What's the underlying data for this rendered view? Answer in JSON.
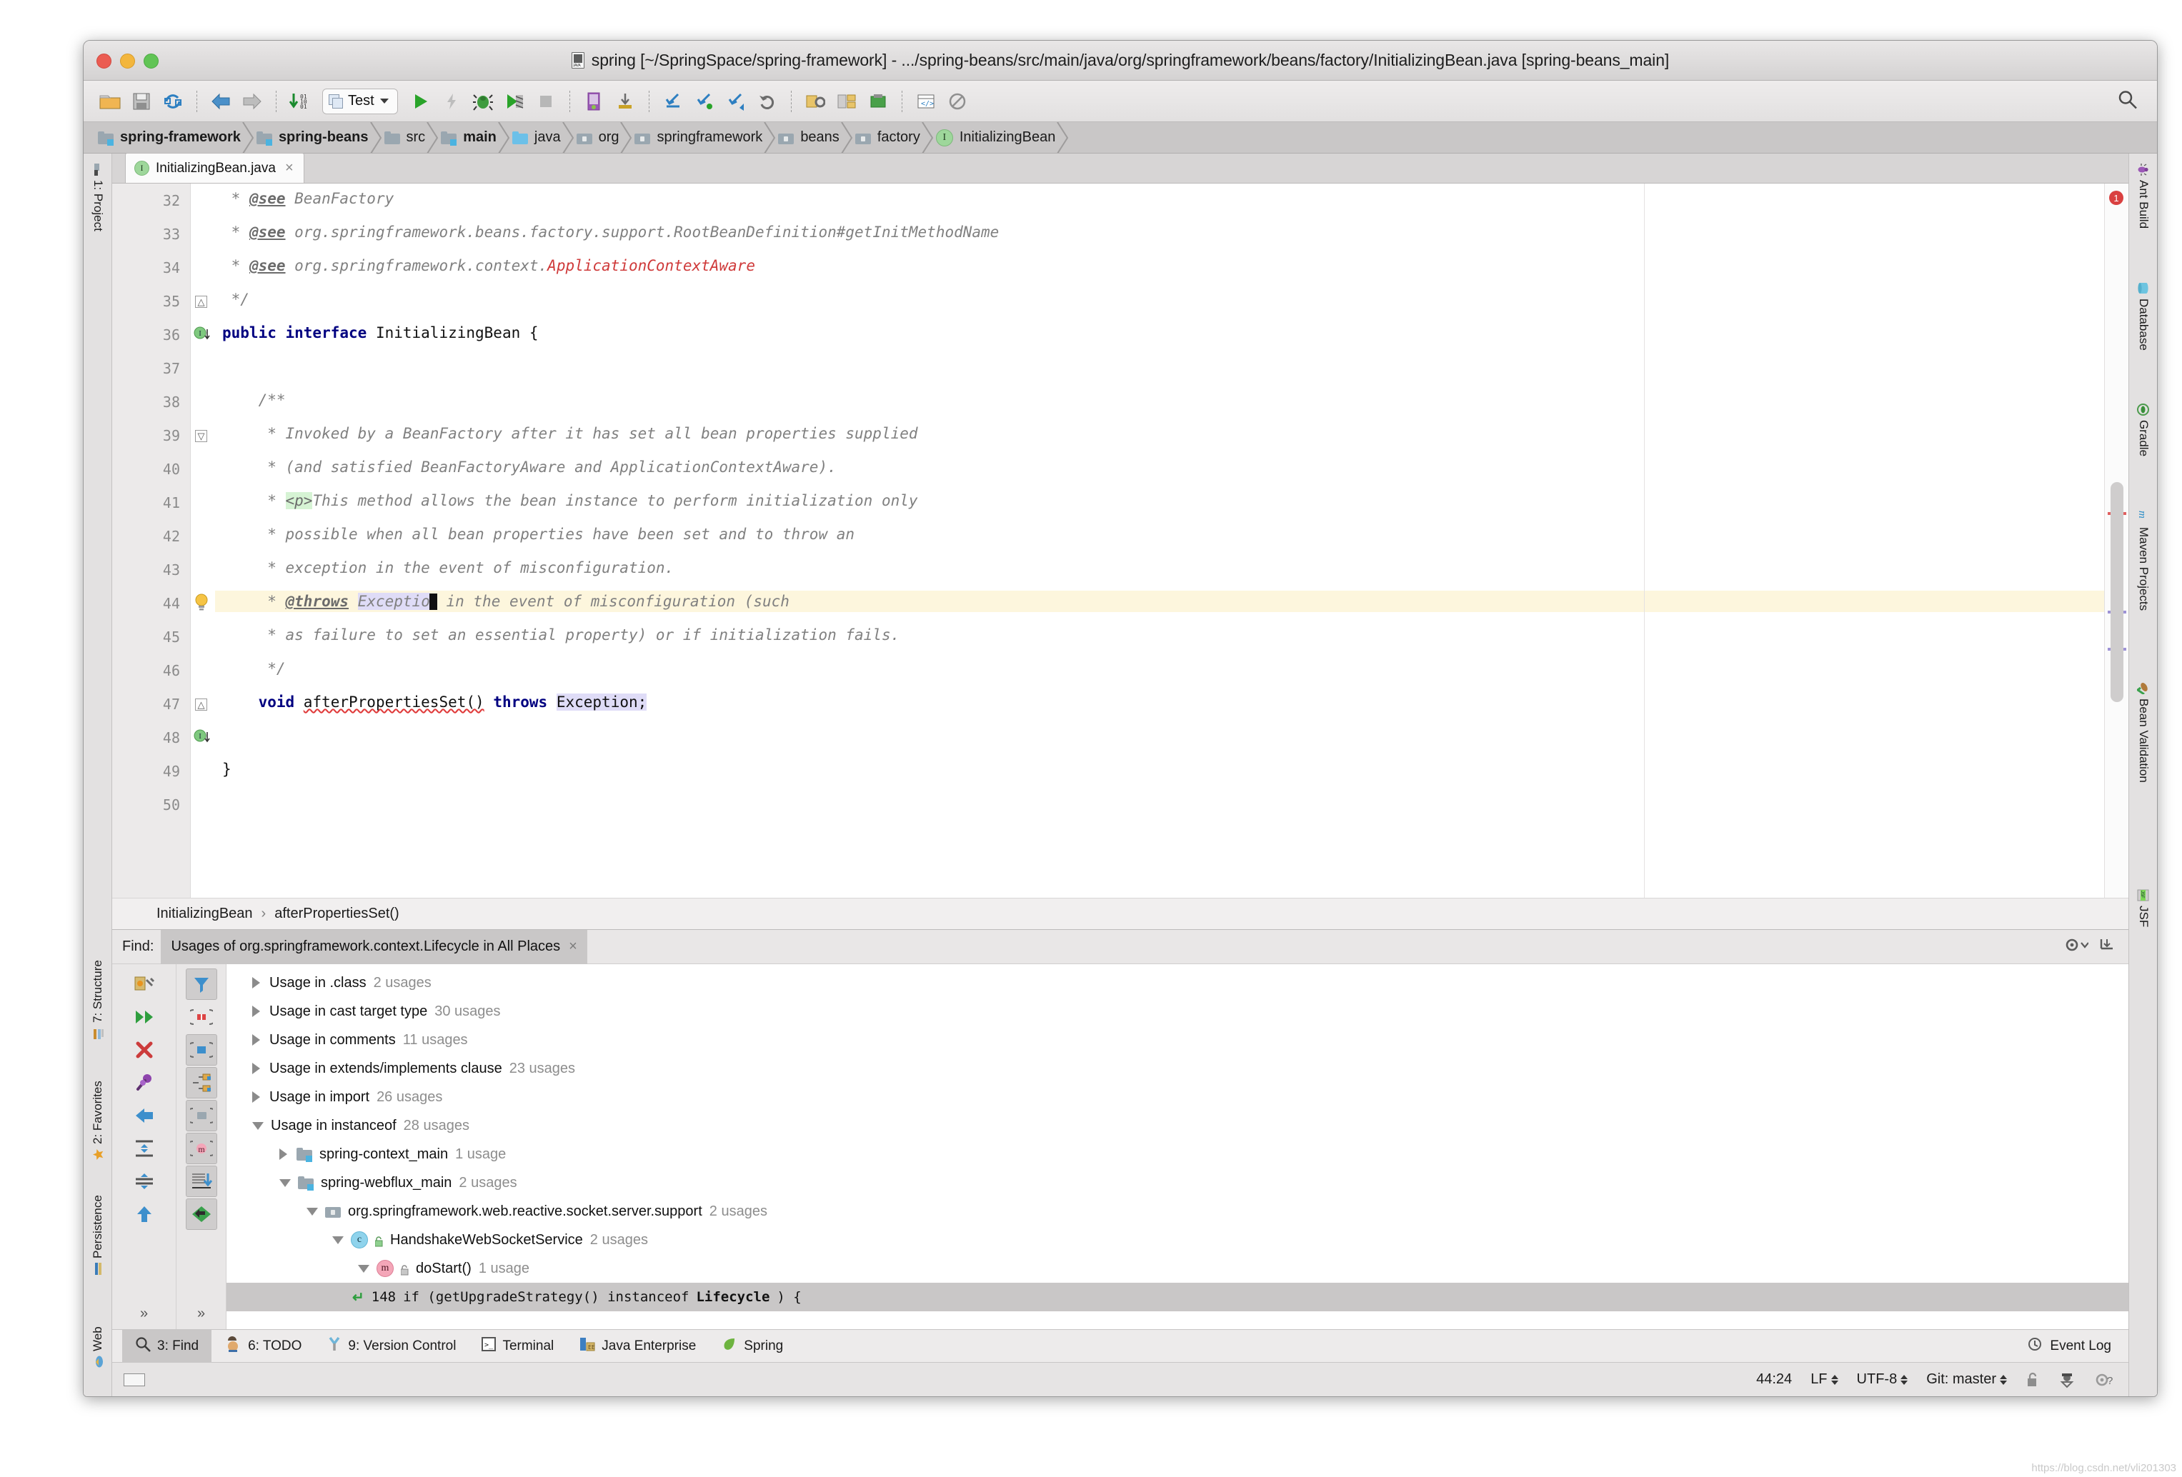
{
  "window": {
    "title": "spring [~/SpringSpace/spring-framework] - .../spring-beans/src/main/java/org/springframework/beans/factory/InitializingBean.java [spring-beans_main]",
    "file_icon": "java-file-icon"
  },
  "toolbar": {
    "run_config": "Test",
    "icons": [
      "open-folder-icon",
      "save-all-icon",
      "sync-icon",
      "back-icon",
      "forward-icon",
      "compile-icon",
      "run-icon",
      "run-fast-icon",
      "debug-icon",
      "coverage-icon",
      "stop-icon",
      "android-device-icon",
      "install-icon",
      "vcs-update-icon",
      "vcs-commit-icon",
      "vcs-push-icon",
      "undo-icon",
      "settings-icon",
      "project-structure-icon",
      "external-tool-icon",
      "web-preview-icon",
      "no-entry-icon"
    ],
    "search_icon": "search-icon"
  },
  "breadcrumb": [
    {
      "label": "spring-framework",
      "icon": "module-folder-icon",
      "bold": true
    },
    {
      "label": "spring-beans",
      "icon": "module-folder-icon",
      "bold": true
    },
    {
      "label": "src",
      "icon": "folder-icon",
      "bold": false
    },
    {
      "label": "main",
      "icon": "module-folder-icon",
      "bold": true
    },
    {
      "label": "java",
      "icon": "source-folder-icon",
      "bold": false
    },
    {
      "label": "org",
      "icon": "package-icon",
      "bold": false
    },
    {
      "label": "springframework",
      "icon": "package-icon",
      "bold": false
    },
    {
      "label": "beans",
      "icon": "package-icon",
      "bold": false
    },
    {
      "label": "factory",
      "icon": "package-icon",
      "bold": false
    },
    {
      "label": "InitializingBean",
      "icon": "interface-icon",
      "bold": false
    }
  ],
  "editor_tabs": [
    {
      "label": "InitializingBean.java",
      "icon": "interface-icon",
      "close": "×"
    }
  ],
  "editor": {
    "first_line": 32,
    "lines": [
      {
        "n": 32,
        "text": " * @see BeanFactory"
      },
      {
        "n": 33,
        "text": " * @see org.springframework.beans.factory.support.RootBeanDefinition#getInitMethodName"
      },
      {
        "n": 34,
        "text": " * @see org.springframework.context.ApplicationContextAware"
      },
      {
        "n": 35,
        "text": " */"
      },
      {
        "n": 36,
        "text": "public interface InitializingBean {"
      },
      {
        "n": 37,
        "text": ""
      },
      {
        "n": 38,
        "text": "    /**"
      },
      {
        "n": 39,
        "text": "     * Invoked by a BeanFactory after it has set all bean properties supplied"
      },
      {
        "n": 40,
        "text": "     * (and satisfied BeanFactoryAware and ApplicationContextAware)."
      },
      {
        "n": 41,
        "text": "     * <p>This method allows the bean instance to perform initialization only"
      },
      {
        "n": 42,
        "text": "     * possible when all bean properties have been set and to throw an"
      },
      {
        "n": 43,
        "text": "     * exception in the event of misconfiguration."
      },
      {
        "n": 44,
        "text": "     * @throws Exception in the event of misconfiguration (such"
      },
      {
        "n": 45,
        "text": "     * as failure to set an essential property) or if initialization fails."
      },
      {
        "n": 46,
        "text": "     */"
      },
      {
        "n": 47,
        "text": "    void afterPropertiesSet() throws Exception;"
      },
      {
        "n": 48,
        "text": ""
      },
      {
        "n": 49,
        "text": "}"
      },
      {
        "n": 50,
        "text": ""
      }
    ],
    "highlighted_line": 44,
    "caret_position": "44:24",
    "bulb_icon": "intention-bulb-icon",
    "error_badge": "1"
  },
  "editor_breadcrumb": {
    "class": "InitializingBean",
    "separator": "›",
    "method": "afterPropertiesSet()"
  },
  "find": {
    "label": "Find:",
    "tab_title": "Usages of org.springframework.context.Lifecycle in All Places",
    "tab_close": "×",
    "settings_icon": "gear-dropdown-icon",
    "hide_icon": "hide-panel-icon",
    "tools_left": [
      "rerun-settings-icon",
      "expand-all-icon",
      "close-icon",
      "pin-icon",
      "previous-occurrence-icon",
      "expand-nodes-icon",
      "collapse-nodes-icon",
      "scroll-up-icon"
    ],
    "tools_right": [
      "filter-icon",
      "preview-icon",
      "autoscroll-icon",
      "group-by-structure-icon",
      "group-by-directory-icon",
      "group-by-module-icon",
      "sort-icon",
      "back-to-source-icon"
    ],
    "expand_chevrons": "»",
    "tree": [
      {
        "indent": 0,
        "state": "closed",
        "icon": "none",
        "label": "Usage in .class",
        "count": "2 usages",
        "selected": false
      },
      {
        "indent": 0,
        "state": "closed",
        "icon": "none",
        "label": "Usage in cast target type",
        "count": "30 usages",
        "selected": false
      },
      {
        "indent": 0,
        "state": "closed",
        "icon": "none",
        "label": "Usage in comments",
        "count": "11 usages",
        "selected": false
      },
      {
        "indent": 0,
        "state": "closed",
        "icon": "none",
        "label": "Usage in extends/implements clause",
        "count": "23 usages",
        "selected": false
      },
      {
        "indent": 0,
        "state": "closed",
        "icon": "none",
        "label": "Usage in import",
        "count": "26 usages",
        "selected": false
      },
      {
        "indent": 0,
        "state": "open",
        "icon": "none",
        "label": "Usage in instanceof",
        "count": "28 usages",
        "selected": false
      },
      {
        "indent": 1,
        "state": "closed",
        "icon": "module-folder-icon",
        "label": "spring-context_main",
        "count": "1 usage",
        "selected": false
      },
      {
        "indent": 1,
        "state": "open",
        "icon": "module-folder-icon",
        "label": "spring-webflux_main",
        "count": "2 usages",
        "selected": false
      },
      {
        "indent": 2,
        "state": "open",
        "icon": "package-icon",
        "label": "org.springframework.web.reactive.socket.server.support",
        "count": "2 usages",
        "selected": false
      },
      {
        "indent": 3,
        "state": "open",
        "icon": "class-icon",
        "label": "HandshakeWebSocketService",
        "count": "2 usages",
        "selected": false
      },
      {
        "indent": 4,
        "state": "open",
        "icon": "method-icon",
        "label": "doStart()",
        "count": "1 usage",
        "selected": false
      }
    ],
    "result_row": {
      "arrow_icon": "goto-source-icon",
      "line_number": "148",
      "code_before": "if (getUpgradeStrategy() instanceof ",
      "code_match": "Lifecycle",
      "code_after": ") {",
      "selected": true
    }
  },
  "tool_windows_bottom": [
    {
      "label": "3: Find",
      "mnemonic": "3",
      "icon": "search-icon",
      "active": true
    },
    {
      "label": "6: TODO",
      "mnemonic": "6",
      "icon": "todo-icon",
      "active": false
    },
    {
      "label": "9: Version Control",
      "mnemonic": "9",
      "icon": "vcs-icon",
      "active": false
    },
    {
      "label": "Terminal",
      "mnemonic": "",
      "icon": "terminal-icon",
      "active": false
    },
    {
      "label": "Java Enterprise",
      "mnemonic": "",
      "icon": "java-ee-icon",
      "active": false
    },
    {
      "label": "Spring",
      "mnemonic": "",
      "icon": "spring-leaf-icon",
      "active": false
    }
  ],
  "event_log": {
    "label": "Event Log",
    "icon": "event-log-icon"
  },
  "tool_windows_left": [
    {
      "label": "1: Project",
      "icon": "project-icon"
    },
    {
      "label": "7: Structure",
      "icon": "structure-icon"
    },
    {
      "label": "2: Favorites",
      "icon": "favorites-star-icon"
    },
    {
      "label": "Persistence",
      "icon": "persistence-icon"
    },
    {
      "label": "Web",
      "icon": "web-icon"
    }
  ],
  "tool_windows_right": [
    {
      "label": "Ant Build",
      "icon": "ant-icon"
    },
    {
      "label": "Database",
      "icon": "database-icon"
    },
    {
      "label": "Gradle",
      "icon": "gradle-icon"
    },
    {
      "label": "Maven Projects",
      "icon": "maven-icon"
    },
    {
      "label": "Bean Validation",
      "icon": "bean-validation-icon"
    },
    {
      "label": "JSF",
      "icon": "jsf-icon"
    }
  ],
  "status_bar": {
    "caret": "44:24",
    "line_separator": "LF",
    "encoding": "UTF-8",
    "branch": "Git: master",
    "lock_icon": "unlocked-icon",
    "inspector_icon": "inspector-icon",
    "help_icon": "gear-help-icon"
  },
  "watermark": "https://blog.csdn.net/vli201303",
  "colors": {
    "keyword": "#000080",
    "comment": "#808080",
    "annotation_red": "#cf3a3a",
    "selection": "#dfdcf7",
    "highlight_row": "#fdf6dd",
    "accent_green": "#2e9e3e"
  }
}
